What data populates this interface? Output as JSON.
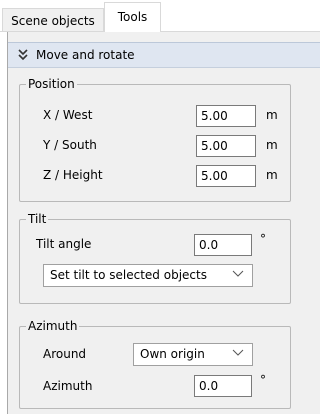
{
  "tabs": [
    {
      "label": "Scene objects",
      "active": false
    },
    {
      "label": "Tools",
      "active": true
    }
  ],
  "section": {
    "chevron_icon": "double-chevron-down-icon",
    "title": "Move and rotate"
  },
  "position": {
    "legend": "Position",
    "x": {
      "label": "X / West",
      "value": "5.00",
      "unit": "m"
    },
    "y": {
      "label": "Y / South",
      "value": "5.00",
      "unit": "m"
    },
    "z": {
      "label": "Z / Height",
      "value": "5.00",
      "unit": "m"
    }
  },
  "tilt": {
    "legend": "Tilt",
    "angle_label": "Tilt angle",
    "angle_value": "0.0",
    "angle_unit": "°",
    "action_dropdown": "Set tilt to selected objects"
  },
  "azimuth": {
    "legend": "Azimuth",
    "around_label": "Around",
    "around_value": "Own origin",
    "azimuth_label": "Azimuth",
    "azimuth_value": "0.0",
    "azimuth_unit": "°"
  }
}
